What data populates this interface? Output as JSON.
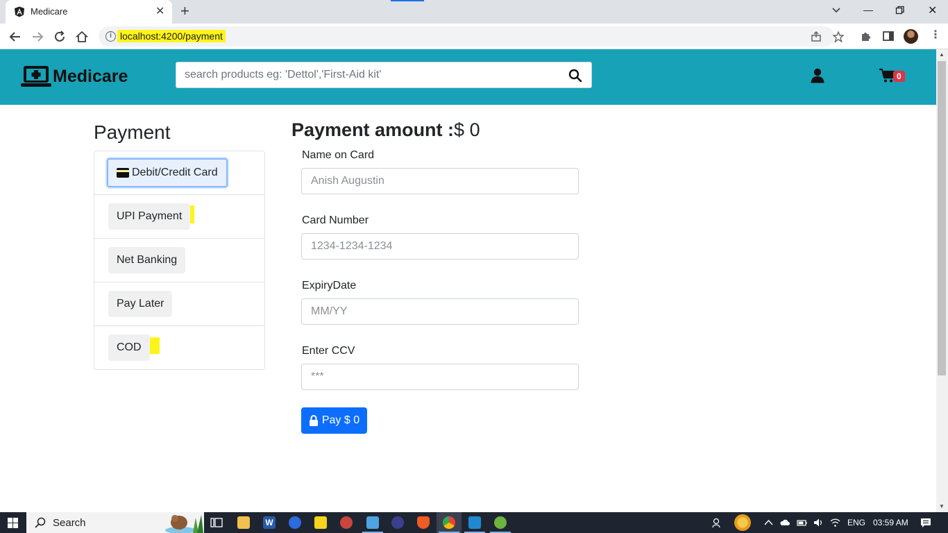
{
  "browser": {
    "tab_title": "Medicare",
    "url": "localhost:4200/payment"
  },
  "header": {
    "brand": "Medicare",
    "search_placeholder": "search products eg: 'Dettol','First-Aid kit'",
    "cart_count": "0"
  },
  "sidebar": {
    "heading": "Payment",
    "methods": [
      {
        "label": "Debit/Credit Card",
        "active": true,
        "icon": "credit-card-icon"
      },
      {
        "label": "UPI Payment",
        "active": false
      },
      {
        "label": "Net Banking",
        "active": false
      },
      {
        "label": "Pay Later",
        "active": false
      },
      {
        "label": "COD",
        "active": false
      }
    ]
  },
  "form": {
    "amount_label": "Payment amount :",
    "amount_value": "$ 0",
    "fields": [
      {
        "label": "Name on Card",
        "placeholder": "Anish Augustin"
      },
      {
        "label": "Card Number",
        "placeholder": "1234-1234-1234"
      },
      {
        "label": "ExpiryDate",
        "placeholder": "MM/YY"
      },
      {
        "label": "Enter CCV",
        "placeholder": "***"
      }
    ],
    "pay_button": "Pay $ 0"
  },
  "taskbar": {
    "search_label": "Search",
    "language": "ENG",
    "time": "03:59 AM"
  },
  "colors": {
    "header_bg": "#17a2b8",
    "primary": "#0d6efd",
    "badge": "#dc3545",
    "highlight": "#fff41a"
  }
}
